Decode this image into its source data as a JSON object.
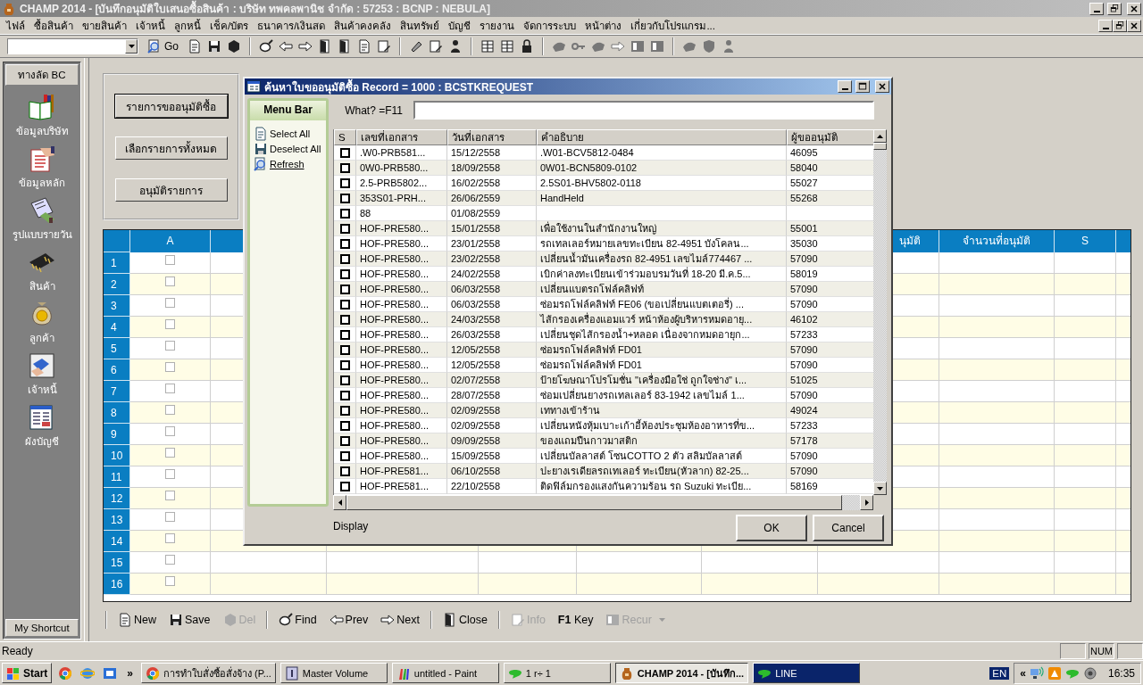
{
  "window": {
    "title": "CHAMP 2014 - [บันทึกอนุมัติใบเสนอซื้อสินค้า : บริษัท ทพคลพานิช จำกัด : 57253 : BCNP : NEBULA]"
  },
  "menu": [
    "ไฟล์",
    "ซื้อสินค้า",
    "ขายสินค้า",
    "เจ้าหนี้",
    "ลูกหนี้",
    "เช็ค/บัตร",
    "ธนาคาร/เงินสด",
    "สินค้าคงคลัง",
    "สินทรัพย์",
    "บัญชี",
    "รายงาน",
    "จัดการระบบ",
    "หน้าต่าง",
    "เกี่ยวกับโปรแกรม..."
  ],
  "toolbar": {
    "go_label": "Go"
  },
  "sidebar": {
    "title": "ทางลัด BC",
    "items": [
      {
        "label": "ข้อมูลบริษัท",
        "kind": "books"
      },
      {
        "label": "ข้อมูลหลัก",
        "kind": "document"
      },
      {
        "label": "รูปแบบรายวัน",
        "kind": "card"
      },
      {
        "label": "สินค้า",
        "kind": "chip"
      },
      {
        "label": "ลูกค้า",
        "kind": "bag"
      },
      {
        "label": "เจ้าหนี้",
        "kind": "hands"
      },
      {
        "label": "ผังบัญชี",
        "kind": "chart"
      }
    ],
    "footer": "My Shortcut"
  },
  "actions": [
    {
      "label": "รายการขออนุมัติซื้อ",
      "default": true
    },
    {
      "label": "เลือกรายการทั้งหมด",
      "default": false
    },
    {
      "label": "อนุมัติรายการ",
      "default": false
    }
  ],
  "grid": {
    "columns": [
      {
        "label": "A"
      },
      {
        "label": "นุมัติ"
      },
      {
        "label": "จำนวนที่อนุมัติ"
      },
      {
        "label": "S"
      }
    ],
    "rows": [
      {
        "number": "1",
        "checked": false
      },
      {
        "number": "2",
        "checked": false
      },
      {
        "number": "3",
        "checked": false
      },
      {
        "number": "4",
        "checked": false
      },
      {
        "number": "5",
        "checked": false
      },
      {
        "number": "6",
        "checked": false
      },
      {
        "number": "7",
        "checked": false
      },
      {
        "number": "8",
        "checked": false
      },
      {
        "number": "9",
        "checked": false
      },
      {
        "number": "10",
        "checked": false
      },
      {
        "number": "11",
        "checked": false
      },
      {
        "number": "12",
        "checked": false
      },
      {
        "number": "13",
        "checked": false
      },
      {
        "number": "14",
        "checked": false
      },
      {
        "number": "15",
        "checked": false
      },
      {
        "number": "16",
        "checked": false
      }
    ]
  },
  "dialog": {
    "title": "ค้นหาใบขออนุมัติซื้อ Record = 1000 : BCSTKREQUEST",
    "menu_title": "Menu Bar",
    "menu_items": [
      {
        "label": "Select All",
        "kind": "page",
        "link": false
      },
      {
        "label": "Deselect All",
        "kind": "disk",
        "link": false
      },
      {
        "label": "Refresh",
        "kind": "search",
        "link": true
      }
    ],
    "search_label": "What? =F11",
    "columns": [
      "S",
      "เลขที่เอกสาร",
      "วันที่เอกสาร",
      "คำอธิบาย",
      "ผู้ขออนุมัติ"
    ],
    "rows": [
      {
        "checked": false,
        "doc_no": ".W0-PRB581...",
        "date": "15/12/2558",
        "description": ".W01-BCV5812-0484",
        "requester": "46095"
      },
      {
        "checked": false,
        "doc_no": "0W0-PRB580...",
        "date": "18/09/2558",
        "description": "0W01-BCN5809-0102",
        "requester": "58040"
      },
      {
        "checked": false,
        "doc_no": "2.5-PRB5802...",
        "date": "16/02/2558",
        "description": "2.5S01-BHV5802-0118",
        "requester": "55027"
      },
      {
        "checked": false,
        "doc_no": "353S01-PRH...",
        "date": "26/06/2559",
        "description": "HandHeld",
        "requester": "55268"
      },
      {
        "checked": false,
        "doc_no": "88",
        "date": "01/08/2559"
      },
      {
        "checked": false,
        "doc_no": "HOF-PRE580...",
        "date": "15/01/2558",
        "description": "เพื่อใช้งานในสำนักงานใหญ่",
        "requester": "55001"
      },
      {
        "checked": false,
        "doc_no": "HOF-PRE580...",
        "date": "23/01/2558",
        "description": "รถเทลเลอร์หมายเลขทะเบียน 82-4951 บังโคลน...",
        "requester": "35030"
      },
      {
        "checked": false,
        "doc_no": "HOF-PRE580...",
        "date": "23/02/2558",
        "description": "เปลี่ยนน้ำมันเครื่องรถ 82-4951 เลขไมล์774467 ...",
        "requester": "57090"
      },
      {
        "checked": false,
        "doc_no": "HOF-PRE580...",
        "date": "24/02/2558",
        "description": "เบิกค่าลงทะเบียนเข้าร่วมอบรมวันที่ 18-20 มี.ค.5...",
        "requester": "58019"
      },
      {
        "checked": false,
        "doc_no": "HOF-PRE580...",
        "date": "06/03/2558",
        "description": "เปลี่ยนแบตรถโฟล์คลิฟท์",
        "requester": "57090"
      },
      {
        "checked": false,
        "doc_no": "HOF-PRE580...",
        "date": "06/03/2558",
        "description": "ซ่อมรถโฟล์คลิฟท์ FE06 (ขอเปลี่ยนแบตเตอรี่)  ...",
        "requester": "57090"
      },
      {
        "checked": false,
        "doc_no": "HOF-PRE580...",
        "date": "24/03/2558",
        "description": "ไส้กรองเครื่องแอมแวร์ หน้าห้องผู้บริหารหมดอายุ...",
        "requester": "46102"
      },
      {
        "checked": false,
        "doc_no": "HOF-PRE580...",
        "date": "26/03/2558",
        "description": "เปลี่ยนชุดไส้กรองน้ำ+หลอด เนื่องจากหมดอายุก...",
        "requester": "57233"
      },
      {
        "checked": false,
        "doc_no": "HOF-PRE580...",
        "date": "12/05/2558",
        "description": "ซ่อมรถโฟล์คลิฟท์ FD01",
        "requester": "57090"
      },
      {
        "checked": false,
        "doc_no": "HOF-PRE580...",
        "date": "12/05/2558",
        "description": "ซ่อมรถโฟล์คลิฟท์ FD01",
        "requester": "57090"
      },
      {
        "checked": false,
        "doc_no": "HOF-PRE580...",
        "date": "02/07/2558",
        "description": "ป้ายโฆษณาโปรโมชั่น \"เครื่องมือใช่ ถูกใจช่าง\" เ...",
        "requester": "51025"
      },
      {
        "checked": false,
        "doc_no": "HOF-PRE580...",
        "date": "28/07/2558",
        "description": "ซ่อมเปลี่ยนยางรถเทลเลอร์ 83-1942  เลขไมล์ 1...",
        "requester": "57090"
      },
      {
        "checked": false,
        "doc_no": "HOF-PRE580...",
        "date": "02/09/2558",
        "description": "เททางเข้าร้าน",
        "requester": "49024"
      },
      {
        "checked": false,
        "doc_no": "HOF-PRE580...",
        "date": "02/09/2558",
        "description": "เปลี่ยนหนังหุ้มเบาะเก้าอี้ห้องประชุมห้องอาหารที่ข...",
        "requester": "57233"
      },
      {
        "checked": false,
        "doc_no": "HOF-PRE580...",
        "date": "09/09/2558",
        "description": "ของแถมปืนกาวมาสติก",
        "requester": "57178"
      },
      {
        "checked": false,
        "doc_no": "HOF-PRE580...",
        "date": "15/09/2558",
        "description": "เปลี่ยนบัลลาสต์ โซนCOTTO 2 ตัว สลิมบัลลาสต์",
        "requester": "57090"
      },
      {
        "checked": false,
        "doc_no": "HOF-PRE581...",
        "date": "06/10/2558",
        "description": "ปะยางเรเดียลรถเทเลอร์ ทะเบียน(หัวลาก) 82-25...",
        "requester": "57090"
      },
      {
        "checked": false,
        "doc_no": "HOF-PRE581...",
        "date": "22/10/2558",
        "description": "ติดฟิล์มกรองแสงกันความร้อน รถ Suzuki ทะเบีย...",
        "requester": "58169"
      }
    ],
    "footer_label": "Display",
    "buttons": [
      "OK",
      "Cancel"
    ]
  },
  "bottom_toolbar": [
    {
      "label": "New",
      "kind": "page",
      "disabled": false,
      "dropdown": false
    },
    {
      "label": "Save",
      "kind": "disk",
      "disabled": false,
      "dropdown": false
    },
    {
      "label": "Del",
      "kind": "hex",
      "disabled": true,
      "dropdown": false
    },
    {
      "label": "Find",
      "kind": "pan",
      "disabled": false,
      "dropdown": false
    },
    {
      "label": "Prev",
      "kind": "left",
      "disabled": false,
      "dropdown": false
    },
    {
      "label": "Next",
      "kind": "right",
      "disabled": false,
      "dropdown": false
    },
    {
      "label": "Close",
      "kind": "door",
      "disabled": false,
      "dropdown": false
    },
    {
      "label": "Info",
      "kind": "pencil",
      "disabled": true,
      "dropdown": false
    },
    {
      "label": "**F1** Key",
      "kind": "none",
      "disabled": false,
      "dropdown": false
    },
    {
      "label": "Recur",
      "kind": "box",
      "disabled": true,
      "dropdown": true
    }
  ],
  "status_bar": {
    "text": "Ready",
    "panels": [
      "NUM"
    ]
  },
  "taskbar": {
    "start": "Start",
    "overflow": "»",
    "tasks": [
      {
        "label": "การทำใบสั่งซื้อสั่งจ้าง (P...",
        "kind": "browser",
        "selected": false,
        "flashing": false
      },
      {
        "label": "Master Volume",
        "kind": "volume",
        "selected": false,
        "flashing": false
      },
      {
        "label": "untitled - Paint",
        "kind": "paint",
        "selected": false,
        "flashing": false
      },
      {
        "label": "1 r÷ 1",
        "kind": "chat",
        "selected": false,
        "flashing": false
      },
      {
        "label": "CHAMP 2014 - [บันทึก...",
        "kind": "vase",
        "selected": true,
        "flashing": false
      },
      {
        "label": "LINE",
        "kind": "chat",
        "selected": false,
        "flashing": true
      }
    ],
    "language": "EN",
    "tray_overflow": "«",
    "time": "16:35"
  }
}
